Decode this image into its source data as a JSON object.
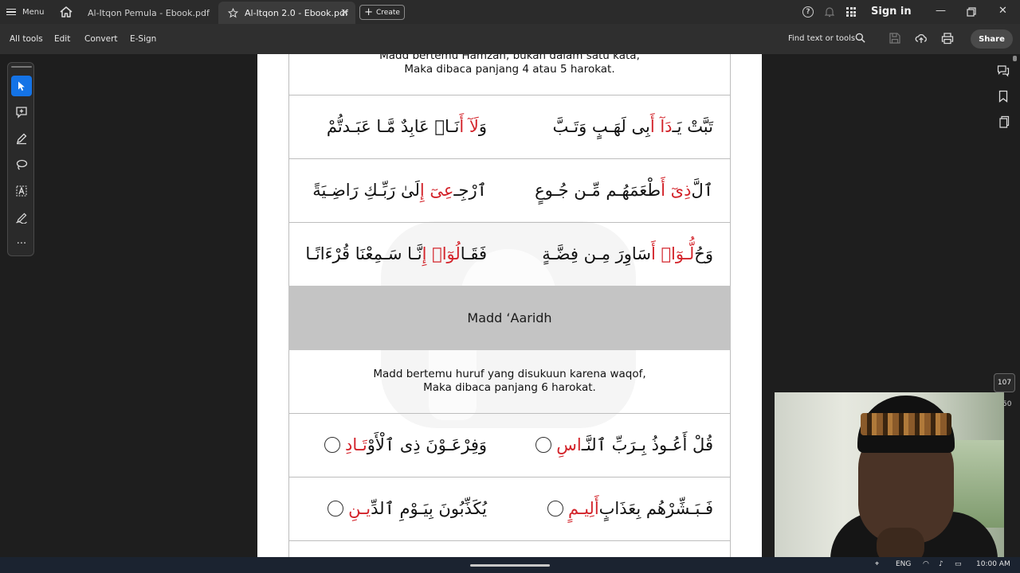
{
  "app": {
    "menu_label": "Menu",
    "tabs": [
      {
        "label": "Al-Itqon Pemula - Ebook.pdf",
        "active": false
      },
      {
        "label": "Al-Itqon 2.0 - Ebook.pdf",
        "active": true
      }
    ],
    "create_label": "Create",
    "sign_in_label": "Sign in"
  },
  "toolbar": {
    "all_tools": "All tools",
    "edit": "Edit",
    "convert": "Convert",
    "esign": "E-Sign",
    "find_placeholder": "Find text or tools",
    "share_label": "Share"
  },
  "right_rail": {
    "page_number": "107",
    "next_number_partial": "50"
  },
  "document": {
    "top_desc_line1": "Madd bertemu Hamzah, bukan dalam satu kata,",
    "top_desc_line2": "Maka dibaca panjang 4 atau 5 harokat.",
    "rows_a": [
      {
        "right": [
          {
            "t": "تَبَّتْ يَـ",
            "red": false
          },
          {
            "t": "دَآ أَ",
            "red": true
          },
          {
            "t": "بِى لَهَـبٍ وَتَـبَّ",
            "red": false
          }
        ],
        "left": [
          {
            "t": "وَ",
            "red": false
          },
          {
            "t": "لَآ أَ",
            "red": true
          },
          {
            "t": "نَـا۠ عَابِدٌ مَّـا عَبَـدتُّمْ",
            "red": false
          }
        ]
      },
      {
        "right": [
          {
            "t": "ٱلَّ",
            "red": false
          },
          {
            "t": "ذِىٓ أَ",
            "red": true
          },
          {
            "t": "طْعَمَهُـم مِّـن جُـوعٍ",
            "red": false
          }
        ],
        "left": [
          {
            "t": "ٱرْجِـ",
            "red": false
          },
          {
            "t": "عِىٓ إِ",
            "red": true
          },
          {
            "t": "لَىٰ رَبِّـكِ رَاضِـيَةً",
            "red": false
          }
        ]
      },
      {
        "right": [
          {
            "t": "وَحُ",
            "red": false
          },
          {
            "t": "لُّـوٓا۟ أَ",
            "red": true
          },
          {
            "t": "سَاوِرَ مِـن فِضَّـةٍ",
            "red": false
          }
        ],
        "left": [
          {
            "t": "فَقَـا",
            "red": false
          },
          {
            "t": "لُوٓا۟ إِ",
            "red": true
          },
          {
            "t": "نَّـا سَـمِعْنَا قُرْءَانًـا",
            "red": false
          }
        ]
      }
    ],
    "section_title": "Madd ‘Aaridh",
    "desc2_line1": "Madd bertemu huruf yang disukuun karena waqof,",
    "desc2_line2": "Maka dibaca panjang 6 harokat.",
    "rows_b": [
      {
        "right": [
          {
            "t": "قُلْ أَعُـوذُ بِـرَبِّ ٱلنَّـ",
            "red": false
          },
          {
            "t": "اسِ",
            "red": true
          }
        ],
        "left": [
          {
            "t": "وَفِرْعَـوْنَ ذِى ٱلْأَوْ",
            "red": false
          },
          {
            "t": "تَـادِ",
            "red": true
          }
        ]
      },
      {
        "right": [
          {
            "t": "فَـبَـشِّرْهُم بِعَذَابٍ ",
            "red": false
          },
          {
            "t": "أَلِيـمٍ",
            "red": true
          }
        ],
        "left": [
          {
            "t": "يُكَذِّبُونَ بِيَـوْمِ ٱلدِّ",
            "red": false
          },
          {
            "t": "يـنِ",
            "red": true
          }
        ]
      }
    ]
  },
  "taskbar": {
    "language": "ENG",
    "time": "10:00 AM"
  },
  "colors": {
    "accent": "#1473e6",
    "tajwid_red": "#d3232a",
    "section_band": "#c4c4c4"
  }
}
